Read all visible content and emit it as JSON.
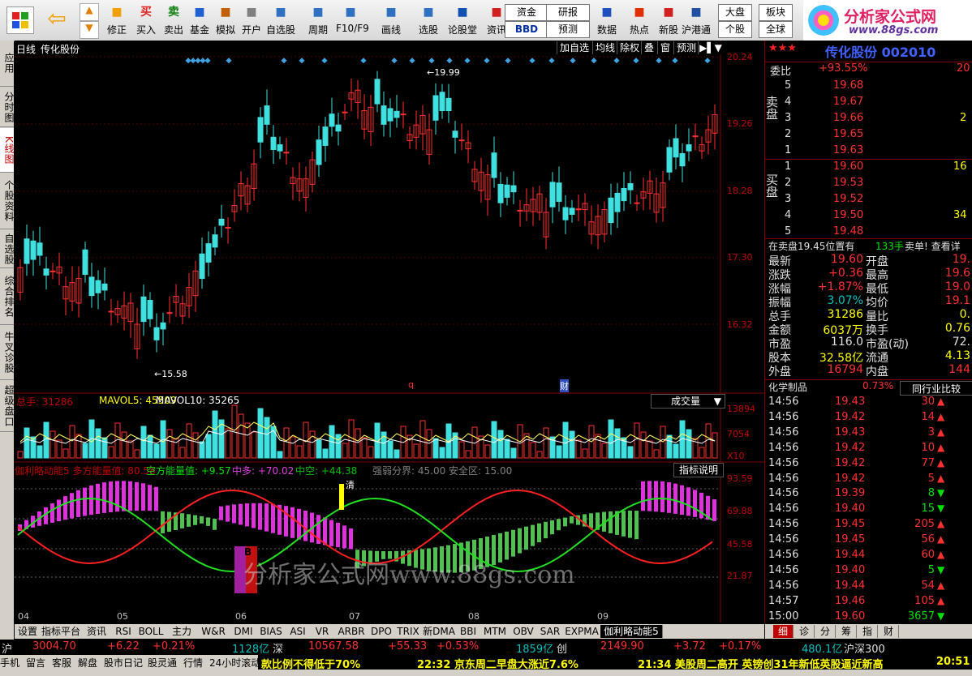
{
  "toolbar": {
    "items": [
      {
        "label": "修正",
        "icon": "refresh-icon"
      },
      {
        "label": "买入",
        "icon": "buy-icon"
      },
      {
        "label": "卖出",
        "icon": "sell-icon"
      },
      {
        "label": "基金",
        "icon": "fund-icon"
      },
      {
        "label": "模拟",
        "icon": "hammer-icon"
      },
      {
        "label": "开户",
        "icon": "lock-icon"
      },
      {
        "label": "自选股",
        "icon": "star-folder-icon"
      },
      {
        "label": "周期",
        "icon": "clock-icon"
      },
      {
        "label": "F10/F9",
        "icon": "f10-icon"
      },
      {
        "label": "画线",
        "icon": "pencil-icon"
      },
      {
        "label": "选股",
        "icon": "select-stock-icon"
      },
      {
        "label": "论股堂",
        "icon": "forum-icon"
      },
      {
        "label": "资讯",
        "icon": "news-icon"
      },
      {
        "label": "数据",
        "icon": "pe-icon"
      },
      {
        "label": "热点",
        "icon": "flame-icon"
      },
      {
        "label": "新股",
        "icon": "new-stock-icon"
      },
      {
        "label": "沪港通",
        "icon": "hk-icon"
      }
    ],
    "small_buttons": {
      "zijin": "资金",
      "bbd": "BBD",
      "yanbao": "研报",
      "yuce": "预测",
      "dapan": "大盘",
      "bankuai": "板块",
      "gegu": "个股",
      "quanqiu": "全球"
    },
    "logo_text": "分析家公式网",
    "logo_url_text": "www.88gs.com",
    "symbols": {
      "buy_char": "买",
      "sell_char": "卖"
    }
  },
  "left_tabs": [
    "应用",
    "分时图",
    "K线图",
    "个股资料",
    "自选股",
    "综合排名",
    "牛叉诊股",
    "超级盘口"
  ],
  "chart": {
    "period": "日线",
    "stock_name": "传化股份",
    "top_buttons": [
      "加自选",
      "均线",
      "除权",
      "叠",
      "窗",
      "预测"
    ],
    "price_axis": [
      "20.24",
      "19.26",
      "18.28",
      "17.30",
      "16.32"
    ],
    "high_mark": "19.99",
    "low_mark": "15.58",
    "markers": [
      "q",
      "财"
    ],
    "volume": {
      "label_total": "总手: 31286",
      "label_ma5": "MAVOL5: 45509",
      "label_ma10": "MAVOL10: 35265",
      "selector": "成交量",
      "axis": [
        "13894",
        "7054"
      ],
      "unit": "X10"
    },
    "indicator": {
      "title": "伽利略动能5 多方能量值: 80.58",
      "kong": "空方能量值: +9.57",
      "zhongduo": "中多: +70.02",
      "zhongkong": "中空: +44.38",
      "rest": "强弱分界: 45.00 安全区: 15.00",
      "help_btn": "指标说明",
      "axis": [
        "93.59",
        "69.88",
        "45.58",
        "21.87"
      ],
      "clear_mark": "清",
      "buy_mark": "B"
    },
    "months": [
      "04",
      "05",
      "06",
      "07",
      "08",
      "09"
    ],
    "watermark": "分析家公式网www.88gs.com"
  },
  "right": {
    "title": "传化股份",
    "code": "002010",
    "weibi_label": "委比",
    "weibi_value": "+93.55%",
    "weibi_extra": "20",
    "sell_label": "卖盘",
    "buy_label": "买盘",
    "sells": [
      {
        "n": "5",
        "p": "19.68"
      },
      {
        "n": "4",
        "p": "19.67"
      },
      {
        "n": "3",
        "p": "19.66",
        "v": "2"
      },
      {
        "n": "2",
        "p": "19.65"
      },
      {
        "n": "1",
        "p": "19.63"
      }
    ],
    "buys": [
      {
        "n": "1",
        "p": "19.60",
        "v": "16"
      },
      {
        "n": "2",
        "p": "19.53"
      },
      {
        "n": "3",
        "p": "19.52"
      },
      {
        "n": "4",
        "p": "19.50",
        "v": "34"
      },
      {
        "n": "5",
        "p": "19.48"
      }
    ],
    "notice": "在卖盘19.45位置有",
    "notice_vol": "133手",
    "notice_tail": "卖单! 查看详",
    "quotes": [
      {
        "l": "最新",
        "v": "19.60",
        "l2": "开盘",
        "v2": "19.",
        "c": "red"
      },
      {
        "l": "涨跌",
        "v": "+0.36",
        "l2": "最高",
        "v2": "19.6",
        "c": "red"
      },
      {
        "l": "涨幅",
        "v": "+1.87%",
        "l2": "最低",
        "v2": "19.0",
        "c": "red"
      },
      {
        "l": "振幅",
        "v": "3.07%",
        "l2": "均价",
        "v2": "19.1",
        "c": "cyn"
      },
      {
        "l": "总手",
        "v": "31286",
        "l2": "量比",
        "v2": "0.",
        "c": "yel"
      },
      {
        "l": "金额",
        "v": "6037万",
        "l2": "换手",
        "v2": "0.76",
        "c": "yel"
      },
      {
        "l": "市盈",
        "v": "116.0",
        "l2": "市盈(动)",
        "v2": "72.",
        "c": "wht"
      },
      {
        "l": "股本",
        "v": "32.58亿",
        "l2": "流通",
        "v2": "4.13",
        "c": "yel"
      },
      {
        "l": "外盘",
        "v": "16794",
        "l2": "内盘",
        "v2": "144",
        "c": "red"
      }
    ],
    "industry": "化学制品",
    "industry_pct": "0.73%",
    "industry_btn": "同行业比较",
    "ticks": [
      {
        "t": "14:56",
        "p": "19.43",
        "v": "30",
        "d": "up"
      },
      {
        "t": "14:56",
        "p": "19.42",
        "v": "14",
        "d": "up"
      },
      {
        "t": "14:56",
        "p": "19.43",
        "v": "3",
        "d": "up"
      },
      {
        "t": "14:56",
        "p": "19.42",
        "v": "10",
        "d": "up"
      },
      {
        "t": "14:56",
        "p": "19.42",
        "v": "77",
        "d": "up"
      },
      {
        "t": "14:56",
        "p": "19.42",
        "v": "5",
        "d": "up"
      },
      {
        "t": "14:56",
        "p": "19.39",
        "v": "8",
        "d": "down"
      },
      {
        "t": "14:56",
        "p": "19.40",
        "v": "15",
        "d": "down"
      },
      {
        "t": "14:56",
        "p": "19.45",
        "v": "205",
        "d": "up"
      },
      {
        "t": "14:56",
        "p": "19.45",
        "v": "56",
        "d": "up"
      },
      {
        "t": "14:56",
        "p": "19.44",
        "v": "60",
        "d": "up"
      },
      {
        "t": "14:56",
        "p": "19.40",
        "v": "5",
        "d": "down"
      },
      {
        "t": "14:56",
        "p": "19.44",
        "v": "54",
        "d": "up"
      },
      {
        "t": "14:57",
        "p": "19.46",
        "v": "105",
        "d": "up"
      },
      {
        "t": "15:00",
        "p": "19.60",
        "v": "3657",
        "d": "down"
      }
    ]
  },
  "bottom_tabs": [
    "设置",
    "指标平台",
    "资讯",
    "RSI",
    "BOLL",
    "主力",
    "W&R",
    "DMI",
    "BIAS",
    "ASI",
    "VR",
    "ARBR",
    "DPO",
    "TRIX",
    "新DMA",
    "BBI",
    "MTM",
    "OBV",
    "SAR",
    "EXPMA",
    "伽利略动能5"
  ],
  "right_tabs": [
    "细",
    "诊",
    "分",
    "筹",
    "指",
    "财"
  ],
  "status": {
    "sh_label": "沪",
    "sh_index": "3004.70",
    "sh_chg": "+6.22",
    "sh_pct": "+0.21%",
    "sh_amt": "1128亿",
    "sz_label": "深",
    "sz_index": "10567.58",
    "sz_chg": "+55.33",
    "sz_pct": "+0.53%",
    "sz_amt": "1859亿",
    "cy_label": "创",
    "cy_index": "2149.90",
    "cy_chg": "+3.72",
    "cy_pct": "+0.17%",
    "cy_amt": "480.1亿",
    "hs_label": "沪深300"
  },
  "statusbar": {
    "items": [
      "手机",
      "留言",
      "客服",
      "解盘",
      "股市日记",
      "股灵通",
      "行情",
      "24小时滚动"
    ],
    "news1": "款比例不得低于70%",
    "news2": "22:32 京东周二早盘大涨近7.6%",
    "news3": "21:34 美股周二高开 英镑创31年新低英股逼近新高",
    "clock": "20:51"
  }
}
